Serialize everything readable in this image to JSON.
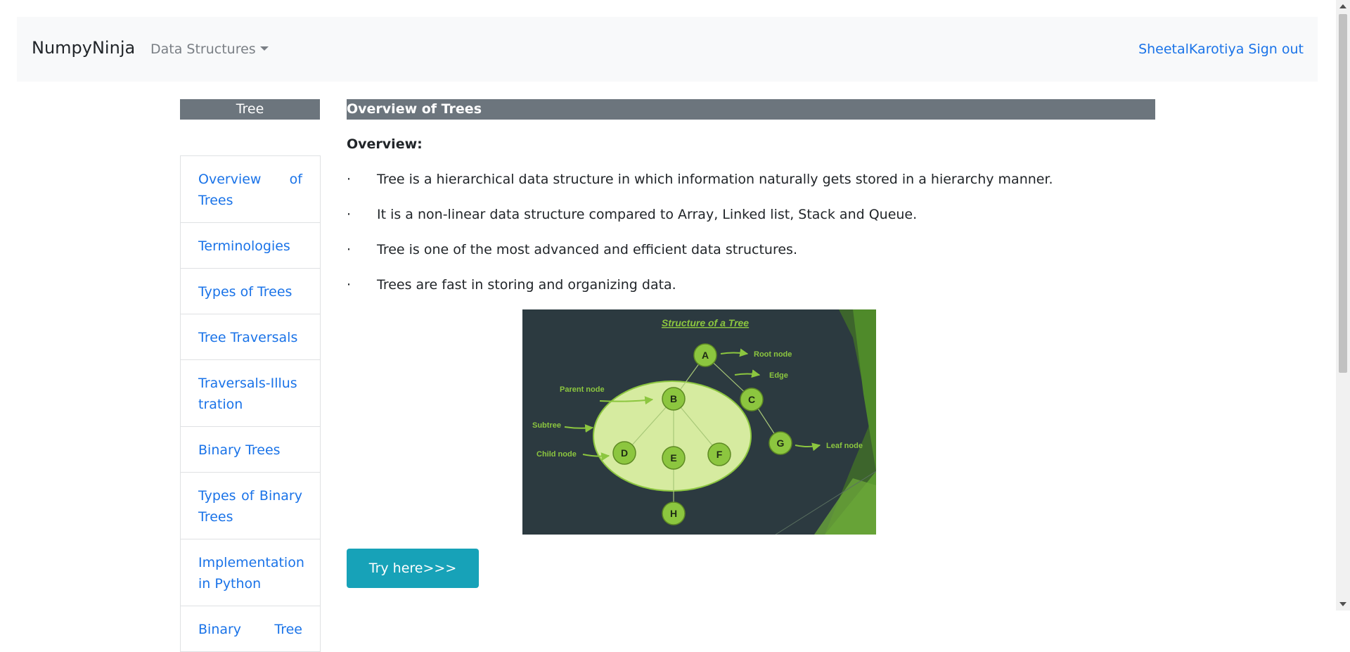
{
  "navbar": {
    "brand": "NumpyNinja",
    "menu_label": "Data Structures",
    "username": "SheetalKarotiya",
    "signout": "Sign out"
  },
  "sidebar": {
    "header": "Tree",
    "items": [
      {
        "label": "Overview of Trees"
      },
      {
        "label": "Terminologies"
      },
      {
        "label": "Types of Trees"
      },
      {
        "label": "Tree Traversals"
      },
      {
        "label": "Traversals-Illustration"
      },
      {
        "label": "Binary Trees"
      },
      {
        "label": "Types of Binary Trees"
      },
      {
        "label": "Implementation in Python"
      },
      {
        "label": "Binary Tree"
      }
    ]
  },
  "main": {
    "title": "Overview of Trees",
    "overview_label": "Overview:",
    "bullet_symbol": "·",
    "bullets": [
      "Tree is a hierarchical data structure in which information naturally gets stored in a hierarchy manner.",
      "It is a non-linear data structure compared to Array, Linked list, Stack and Queue.",
      "Tree is one of the most advanced and efficient data structures.",
      "Trees are fast in storing and organizing data."
    ],
    "try_button": "Try here>>>"
  },
  "diagram": {
    "title": "Structure of a Tree",
    "nodes": [
      "A",
      "B",
      "C",
      "D",
      "E",
      "F",
      "G",
      "H"
    ],
    "labels": {
      "root": "Root node",
      "edge": "Edge",
      "parent": "Parent node",
      "subtree": "Subtree",
      "child": "Child node",
      "leaf": "Leaf node"
    }
  },
  "colors": {
    "link": "#1a73e8",
    "header_bg": "#6c757d",
    "button_bg": "#17a2b8",
    "diagram_bg": "#2c3a40",
    "node_green": "#8cc63f",
    "subtree_fill": "#d6eba0"
  }
}
